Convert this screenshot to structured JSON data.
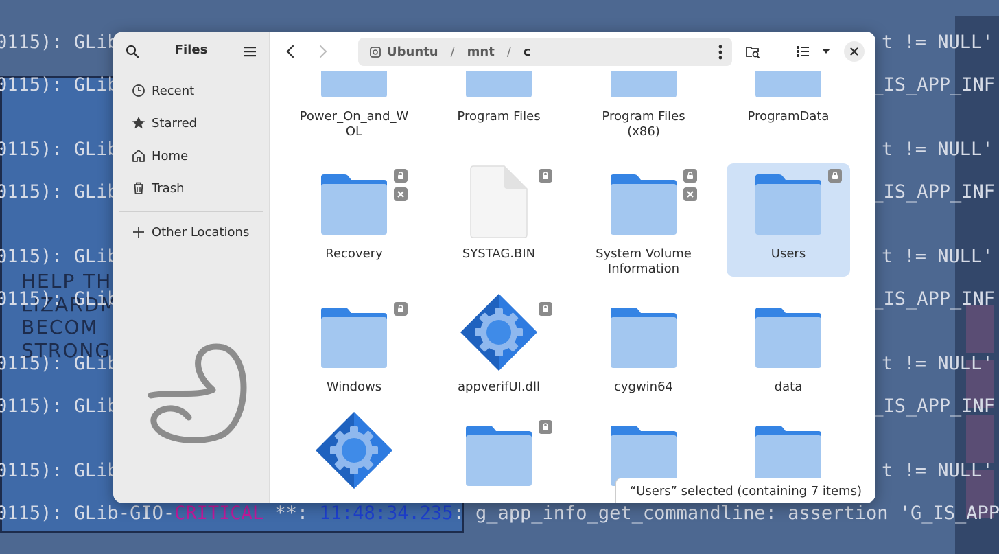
{
  "terminal": {
    "lines": [
      {
        "text": "0115): GLib-GIO-CRITICAL **: 11:48:34.235: g_app_info_get_commandline: assertion 'G_IS_APP_INF",
        "prefix": "0115): GLib-GIO-",
        "crit": "CRITICAL",
        "mid": " **: ",
        "time": "11:48:34.235",
        "tail": ": g_app_info_get_commandline: assertion 'G_IS_APP_INF"
      }
    ],
    "left_fragment": "0115): GLib",
    "right_fragment_a": "t != NULL' f",
    "right_fragment_b": "G_IS_APP_INF",
    "art_text": "HELP TH\nLIZARDMA\nBECOM\nSTRONGE"
  },
  "sidebar": {
    "title": "Files",
    "items": [
      {
        "label": "Recent",
        "icon": "clock-icon"
      },
      {
        "label": "Starred",
        "icon": "star-icon"
      },
      {
        "label": "Home",
        "icon": "home-icon"
      },
      {
        "label": "Trash",
        "icon": "trash-icon"
      }
    ],
    "other_locations": "Other Locations"
  },
  "path": {
    "crumbs": [
      "Ubuntu",
      "mnt",
      "c"
    ],
    "separator": "/"
  },
  "files": [
    {
      "name": "Power_On_and_WOL",
      "display": "Power_On_and_W\nOL",
      "type": "folder"
    },
    {
      "name": "Program Files",
      "display": "Program Files",
      "type": "folder"
    },
    {
      "name": "Program Files (x86)",
      "display": "Program Files\n(x86)",
      "type": "folder"
    },
    {
      "name": "ProgramData",
      "display": "ProgramData",
      "type": "folder"
    },
    {
      "name": "Recovery",
      "display": "Recovery",
      "type": "folder",
      "locked": true,
      "unreadable": true
    },
    {
      "name": "SYSTAG.BIN",
      "display": "SYSTAG.BIN",
      "type": "file",
      "locked": true
    },
    {
      "name": "System Volume Information",
      "display": "System Volume\nInformation",
      "type": "folder",
      "locked": true,
      "unreadable": true
    },
    {
      "name": "Users",
      "display": "Users",
      "type": "folder",
      "locked": true,
      "selected": true
    },
    {
      "name": "Windows",
      "display": "Windows",
      "type": "folder",
      "locked": true
    },
    {
      "name": "appverifUI.dll",
      "display": "appverifUI.dll",
      "type": "library",
      "locked": true
    },
    {
      "name": "cygwin64",
      "display": "cygwin64",
      "type": "folder"
    },
    {
      "name": "data",
      "display": "data",
      "type": "folder"
    },
    {
      "name": "",
      "display": "",
      "type": "library"
    },
    {
      "name": "",
      "display": "",
      "type": "folder",
      "locked": true
    },
    {
      "name": "",
      "display": "",
      "type": "folder"
    },
    {
      "name": "",
      "display": "",
      "type": "folder"
    }
  ],
  "status": "“Users” selected (containing 7 items)",
  "colors": {
    "folder_back": "#3584e4",
    "folder_front": "#a3c7f0",
    "selection": "#cfe1f7",
    "sidebar_bg": "#ebebeb"
  }
}
